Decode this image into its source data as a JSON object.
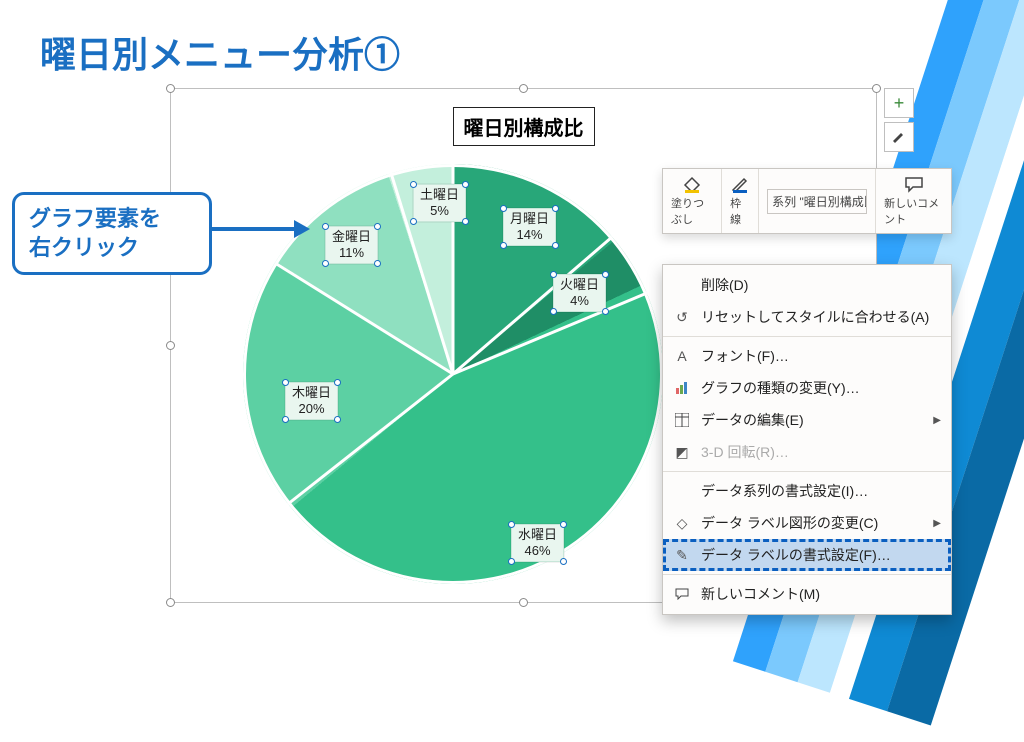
{
  "title": "曜日別メニュー分析①",
  "callout": {
    "line1": "グラフ要素を",
    "line2": "右クリック"
  },
  "chart_data": {
    "type": "pie",
    "title": "曜日別構成比",
    "categories": [
      "月曜日",
      "火曜日",
      "水曜日",
      "木曜日",
      "金曜日",
      "土曜日"
    ],
    "values": [
      14,
      4,
      46,
      20,
      11,
      5
    ],
    "labels": [
      {
        "name": "月曜日",
        "pct": "14%"
      },
      {
        "name": "火曜日",
        "pct": "4%"
      },
      {
        "name": "水曜日",
        "pct": "46%"
      },
      {
        "name": "木曜日",
        "pct": "20%"
      },
      {
        "name": "金曜日",
        "pct": "11%"
      },
      {
        "name": "土曜日",
        "pct": "5%"
      }
    ],
    "colors": [
      "#28a779",
      "#1f8e66",
      "#34c08a",
      "#5cd0a3",
      "#8fe0c0",
      "#c3efdc"
    ]
  },
  "side_buttons": {
    "add": "+",
    "brush": "brush",
    "filter": "filter"
  },
  "mini_toolbar": {
    "fill": "塗りつぶし",
    "outline": "枠線",
    "series": "系列 \"曜日別構成比\"",
    "comment": "新しいコメント"
  },
  "menu": {
    "delete": "削除(D)",
    "reset": "リセットしてスタイルに合わせる(A)",
    "font": "フォント(F)…",
    "change_type": "グラフの種類の変更(Y)…",
    "edit_data": "データの編集(E)",
    "rotate3d": "3-D 回転(R)…",
    "format_series": "データ系列の書式設定(I)…",
    "change_label_shape": "データ ラベル図形の変更(C)",
    "format_labels": "データ ラベルの書式設定(F)…",
    "new_comment": "新しいコメント(M)"
  }
}
